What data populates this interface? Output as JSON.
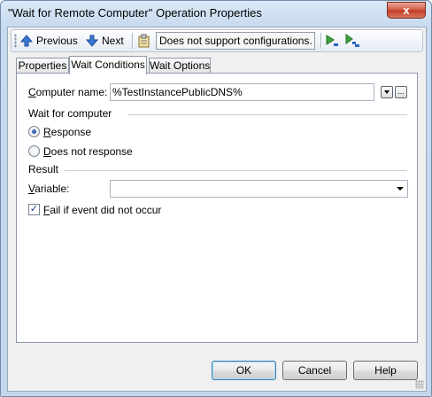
{
  "window": {
    "title": "\"Wait for Remote Computer\" Operation Properties",
    "close_label": "x"
  },
  "toolbar": {
    "previous_label": "Previous",
    "next_label": "Next",
    "config_label": "Does not support configurations."
  },
  "tabs": [
    {
      "label": "Properties"
    },
    {
      "label": "Wait Conditions"
    },
    {
      "label": "Wait Options"
    }
  ],
  "form": {
    "computer_name_label": "Computer name:",
    "computer_name_value": "%TestInstancePublicDNS%",
    "browse_label": "...",
    "wait_group_label": "Wait for computer",
    "radio_response": "Response",
    "radio_no_response": "Does not response",
    "result_group_label": "Result",
    "variable_label": "Variable:",
    "variable_value": "",
    "fail_checkbox_label": "Fail if event did not occur"
  },
  "buttons": {
    "ok": "OK",
    "cancel": "Cancel",
    "help": "Help"
  },
  "colors": {
    "accent": "#2c64c5",
    "titlebar": "#c7daef",
    "close": "#c13a24"
  }
}
